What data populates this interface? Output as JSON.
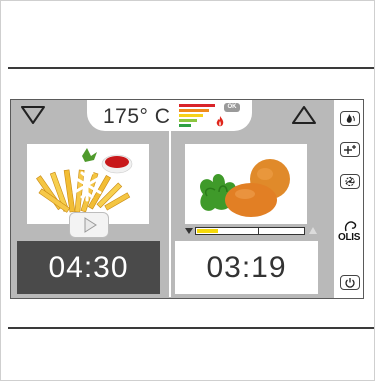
{
  "header": {
    "temperature": "175° C",
    "energy_badge": "OK"
  },
  "left_panel": {
    "timer": "04:30",
    "image_subject": "frozen fries with ketchup",
    "mode_icon": "snowflake-icon"
  },
  "right_panel": {
    "timer": "03:19",
    "image_subject": "potatoes",
    "progress": 0.2
  },
  "sidebar": {
    "icons": [
      "steam-icon",
      "humidity-adjust-icon",
      "fan-icon",
      "power-icon"
    ],
    "logo_text": "OLIS"
  },
  "colors": {
    "screen_bg": "#b9b9b9",
    "dark_timer_bg": "#4a4a4a",
    "progress_fill": "#f5d90a",
    "energy_bars": [
      "#d9242a",
      "#f08a1c",
      "#f7d21a",
      "#8cc63f",
      "#2ea043"
    ]
  }
}
